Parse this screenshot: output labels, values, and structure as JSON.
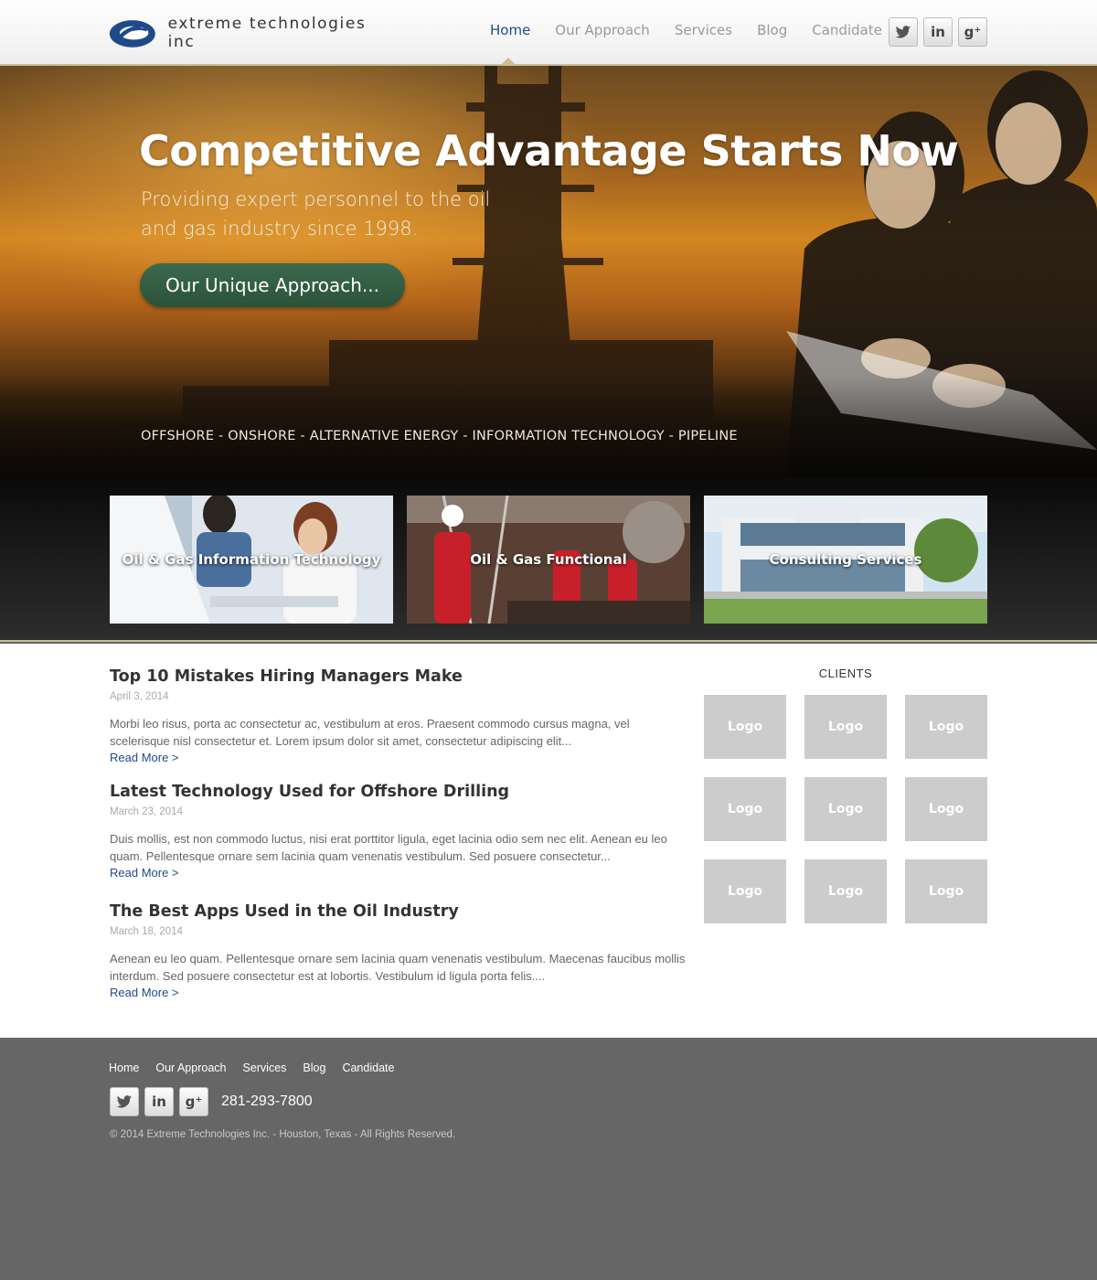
{
  "brand": {
    "name": "extreme technologies inc",
    "accent": "#1f4a8a",
    "gold": "#c9bf95",
    "green": "#2f5a3f"
  },
  "nav": {
    "items": [
      {
        "label": "Home",
        "active": true
      },
      {
        "label": "Our Approach",
        "active": false
      },
      {
        "label": "Services",
        "active": false
      },
      {
        "label": "Blog",
        "active": false
      },
      {
        "label": "Candidate",
        "active": false
      }
    ]
  },
  "social": [
    {
      "icon": "twitter-icon",
      "glyph": "🐦"
    },
    {
      "icon": "linkedin-icon",
      "glyph": "in"
    },
    {
      "icon": "google-plus-icon",
      "glyph": "g⁺"
    }
  ],
  "hero": {
    "title": "Competitive Advantage Starts Now",
    "subtitle": "Providing expert personnel to the oil and gas industry since 1998.",
    "button_label": "Our Unique Approach...",
    "tagline": "OFFSHORE - ONSHORE - ALTERNATIVE ENERGY - INFORMATION TECHNOLOGY - PIPELINE"
  },
  "services": [
    {
      "label": "Oil & Gas Information Technology"
    },
    {
      "label": "Oil & Gas Functional"
    },
    {
      "label": "Consulting Services"
    }
  ],
  "posts": [
    {
      "title": "Top 10 Mistakes Hiring Managers Make",
      "date": "April 3, 2014",
      "excerpt": "Morbi leo risus, porta ac consectetur ac, vestibulum at eros. Praesent commodo cursus magna, vel scelerisque nisl consectetur et. Lorem ipsum dolor sit amet, consectetur adipiscing elit...",
      "read_more": "Read More >"
    },
    {
      "title": "Latest Technology Used for Offshore Drilling",
      "date": "March 23, 2014",
      "excerpt": "Duis mollis, est non commodo luctus, nisi erat porttitor ligula, eget lacinia odio sem nec elit. Aenean eu leo quam. Pellentesque ornare sem lacinia quam venenatis vestibulum. Sed posuere consectetur...",
      "read_more": "Read More >"
    },
    {
      "title": "The Best Apps Used in the Oil Industry",
      "date": "March 18, 2014",
      "excerpt": "Aenean eu leo quam. Pellentesque ornare sem lacinia quam venenatis vestibulum. Maecenas faucibus mollis interdum. Sed posuere consectetur est at lobortis. Vestibulum id ligula porta felis....",
      "read_more": "Read More >"
    }
  ],
  "clients": {
    "title": "CLIENTS",
    "logos": [
      "Logo",
      "Logo",
      "Logo",
      "Logo",
      "Logo",
      "Logo",
      "Logo",
      "Logo",
      "Logo"
    ]
  },
  "footer": {
    "nav": [
      "Home",
      "Our Approach",
      "Services",
      "Blog",
      "Candidate"
    ],
    "phone": "281-293-7800",
    "copyright": "© 2014 Extreme Technologies Inc. - Houston, Texas - All Rights Reserved."
  }
}
